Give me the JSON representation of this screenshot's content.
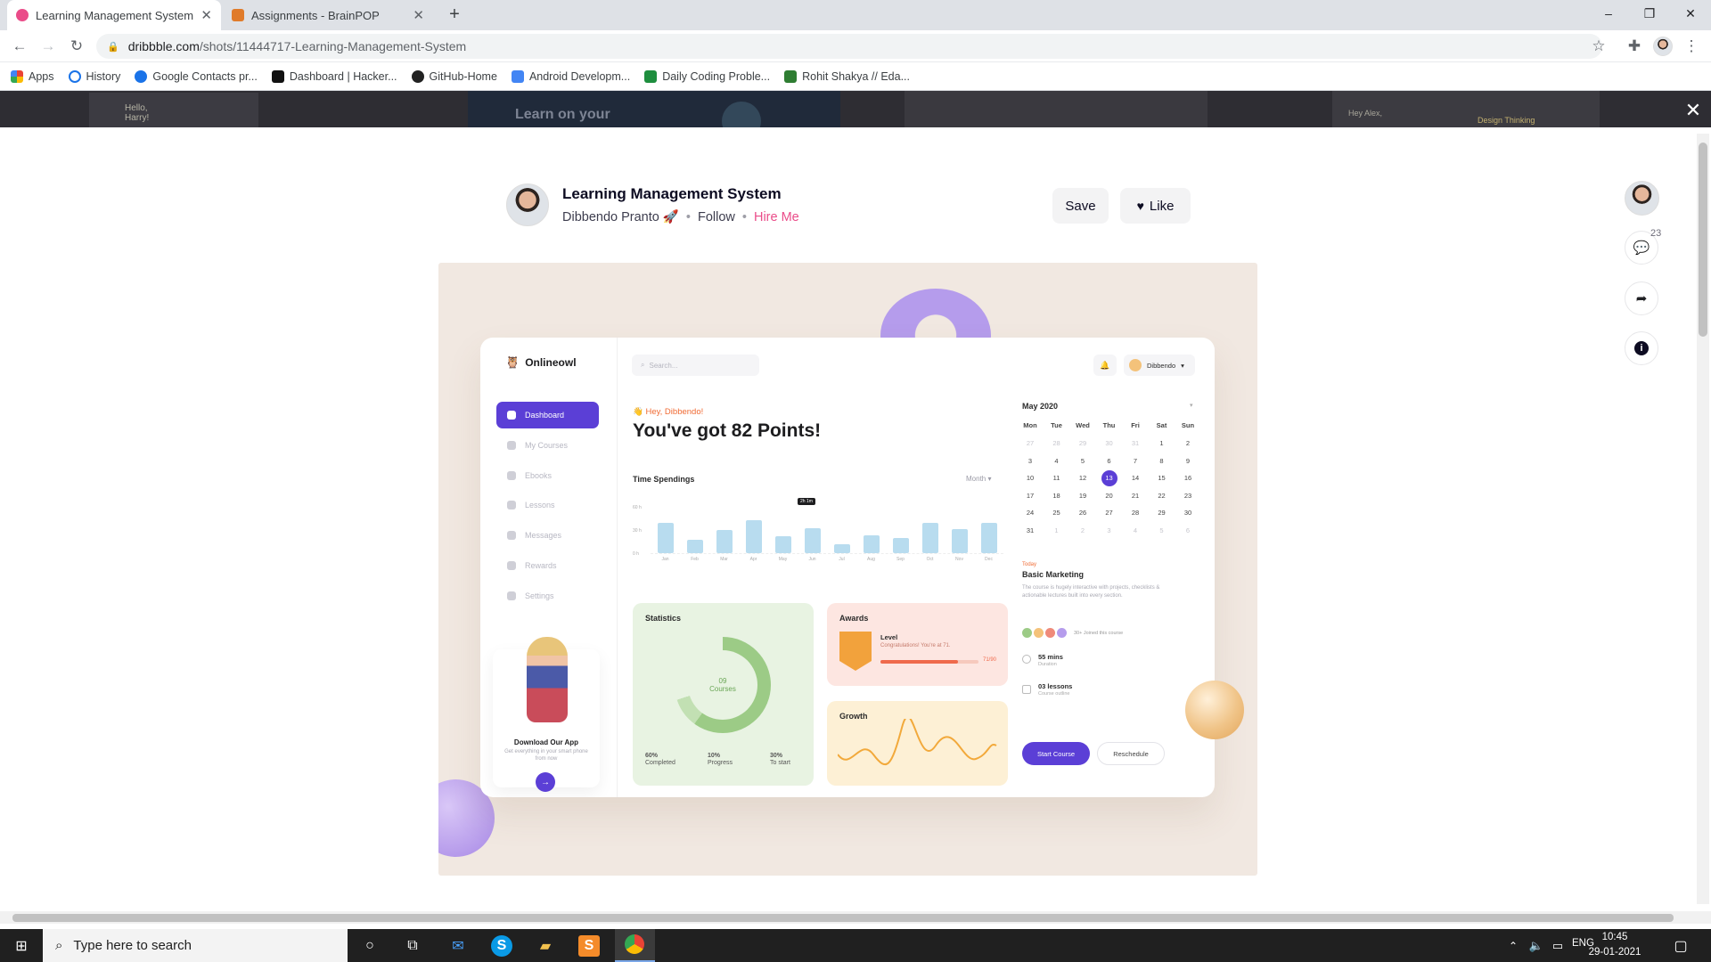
{
  "browser": {
    "tabs": [
      {
        "title": "Learning Management System b",
        "active": true
      },
      {
        "title": "Assignments - BrainPOP",
        "active": false
      }
    ],
    "new_tab": "+",
    "window_controls": {
      "minimize": "–",
      "restore": "❐",
      "close": "✕"
    },
    "url_host": "dribbble.com",
    "url_path": "/shots/11444717-Learning-Management-System",
    "bookmarks": [
      "Apps",
      "History",
      "Google Contacts pr...",
      "Dashboard | Hacker...",
      "GitHub-Home",
      "Android Developm...",
      "Daily Coding Proble...",
      "Rohit Shakya // Eda..."
    ]
  },
  "shot": {
    "title": "Learning Management System",
    "author": "Dibbendo Pranto 🚀",
    "sep": "•",
    "follow": "Follow",
    "hire": "Hire Me",
    "save": "Save",
    "like": "Like",
    "comments_count": "23"
  },
  "backdrop": {
    "text_a": "Learn on your",
    "text_b": "Hello,\nHarry!",
    "text_c": "Hey Alex,",
    "text_d": "Design Thinking"
  },
  "dashboard": {
    "brand": "Onlineowl",
    "search_placeholder": "Search...",
    "user": "Dibbendo",
    "menu": [
      "Dashboard",
      "My Courses",
      "Ebooks",
      "Lessons",
      "Messages",
      "Rewards",
      "Settings"
    ],
    "greeting": "👋 Hey, Dibbendo!",
    "headline": "You've got 82 Points!",
    "time_title": "Time Spendings",
    "month_filter": "Month",
    "bar_tip": "2h 1m",
    "y_ticks": [
      "60 h",
      "30 h",
      "0 h"
    ],
    "app_title": "Download Our App",
    "app_sub": "Get everything in your smart phone from now",
    "stats": {
      "title": "Statistics",
      "center_value": "09",
      "center_label": "Courses",
      "legend": [
        {
          "v": "60%",
          "l": "Completed"
        },
        {
          "v": "10%",
          "l": "Progress"
        },
        {
          "v": "30%",
          "l": "To start"
        }
      ]
    },
    "awards": {
      "title": "Awards",
      "level": "Level",
      "congrats": "Congratulations! You're at 71.",
      "score": "71/90"
    },
    "growth": {
      "title": "Growth"
    },
    "calendar": {
      "title": "May 2020",
      "days": [
        "Mon",
        "Tue",
        "Wed",
        "Thu",
        "Fri",
        "Sat",
        "Sun"
      ],
      "weeks": [
        [
          "27",
          "28",
          "29",
          "30",
          "31",
          "1",
          "2"
        ],
        [
          "3",
          "4",
          "5",
          "6",
          "7",
          "8",
          "9"
        ],
        [
          "10",
          "11",
          "12",
          "13",
          "14",
          "15",
          "16"
        ],
        [
          "17",
          "18",
          "19",
          "20",
          "21",
          "22",
          "23"
        ],
        [
          "24",
          "25",
          "26",
          "27",
          "28",
          "29",
          "30"
        ],
        [
          "31",
          "1",
          "2",
          "3",
          "4",
          "5",
          "6"
        ]
      ],
      "selected": "13"
    },
    "event": {
      "tag": "Today",
      "title": "Basic Marketing",
      "desc": "The course is hugely interactive with projects, checklists & actionable lectures built into every section.",
      "joined": "30+ Joined this course",
      "duration": "55 mins",
      "duration_lbl": "Duration",
      "lessons": "03 lessons",
      "lessons_lbl": "Course outline",
      "start": "Start Course",
      "reschedule": "Reschedule"
    }
  },
  "chart_data": {
    "type": "bar",
    "title": "Time Spendings",
    "categories": [
      "Jan",
      "Feb",
      "Mar",
      "Apr",
      "May",
      "Jun",
      "Jul",
      "Aug",
      "Sep",
      "Oct",
      "Nov",
      "Dec"
    ],
    "values": [
      38,
      17,
      29,
      42,
      22,
      32,
      11,
      23,
      19,
      38,
      31,
      38
    ],
    "ylim": [
      0,
      60
    ],
    "y_ticks": [
      "60 h",
      "30 h",
      "0 h"
    ],
    "grid": true
  },
  "taskbar": {
    "search_placeholder": "Type here to search",
    "lang": "ENG",
    "time": "10:45",
    "date": "29-01-2021"
  }
}
